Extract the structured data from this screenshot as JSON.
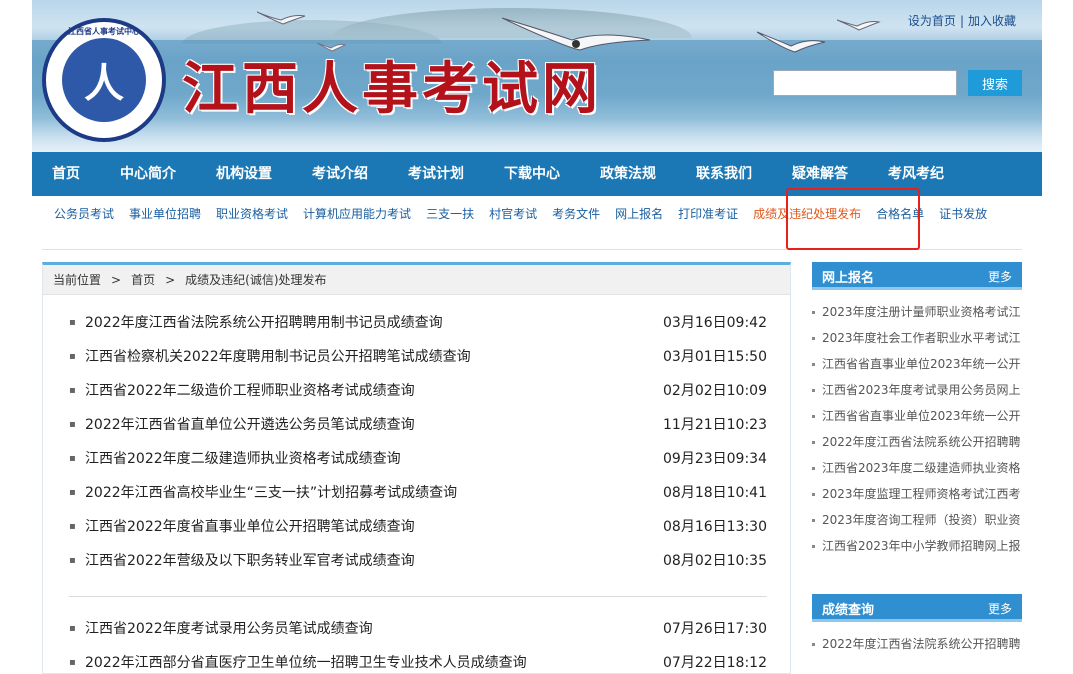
{
  "header": {
    "site_title": "江西人事考试网",
    "emblem_glyph": "人",
    "emblem_ring_text": "江西省人事考试中心",
    "top_links": [
      "设为首页",
      "加入收藏"
    ],
    "search_placeholder": "",
    "search_button": "搜索"
  },
  "main_nav": [
    "首页",
    "中心简介",
    "机构设置",
    "考试介绍",
    "考试计划",
    "下载中心",
    "政策法规",
    "联系我们",
    "疑难解答",
    "考风考纪"
  ],
  "sub_nav": {
    "items": [
      "公务员考试",
      "事业单位招聘",
      "职业资格考试",
      "计算机应用能力考试",
      "三支一扶",
      "村官考试",
      "考务文件",
      "网上报名",
      "打印准考证",
      "成绩及违纪处理发布",
      "合格名单",
      "证书发放"
    ],
    "active": "成绩及违纪处理发布"
  },
  "breadcrumb": {
    "label": "当前位置",
    "sep": ">",
    "home": "首页",
    "current": "成绩及违纪(诚信)处理发布"
  },
  "news": [
    {
      "title": "2022年度江西省法院系统公开招聘聘用制书记员成绩查询",
      "date": "03月16日09:42"
    },
    {
      "title": "江西省检察机关2022年度聘用制书记员公开招聘笔试成绩查询",
      "date": "03月01日15:50"
    },
    {
      "title": "江西省2022年二级造价工程师职业资格考试成绩查询",
      "date": "02月02日10:09"
    },
    {
      "title": "2022年江西省省直单位公开遴选公务员笔试成绩查询",
      "date": "11月21日10:23"
    },
    {
      "title": "江西省2022年度二级建造师执业资格考试成绩查询",
      "date": "09月23日09:34"
    },
    {
      "title": "2022年江西省高校毕业生“三支一扶”计划招募考试成绩查询",
      "date": "08月18日10:41"
    },
    {
      "title": "江西省2022年度省直事业单位公开招聘笔试成绩查询",
      "date": "08月16日13:30"
    },
    {
      "title": "江西省2022年营级及以下职务转业军官考试成绩查询",
      "date": "08月02日10:35"
    }
  ],
  "news2": [
    {
      "title": "江西省2022年度考试录用公务员笔试成绩查询",
      "date": "07月26日17:30"
    },
    {
      "title": "2022年江西部分省直医疗卫生单位统一招聘卫生专业技术人员成绩查询",
      "date": "07月22日18:12"
    }
  ],
  "sidebar": {
    "registration": {
      "title": "网上报名",
      "more": "更多",
      "items": [
        "2023年度注册计量师职业资格考试江",
        "2023年度社会工作者职业水平考试江",
        "江西省省直事业单位2023年统一公开",
        "江西省2023年度考试录用公务员网上",
        "江西省省直事业单位2023年统一公开",
        "2022年度江西省法院系统公开招聘聘",
        "江西省2023年度二级建造师执业资格",
        "2023年度监理工程师资格考试江西考",
        "2023年度咨询工程师（投资）职业资",
        "江西省2023年中小学教师招聘网上报"
      ]
    },
    "scores": {
      "title": "成绩查询",
      "more": "更多",
      "items": [
        "2022年度江西省法院系统公开招聘聘"
      ]
    }
  },
  "colors": {
    "nav_bg": "#1b78b5",
    "active_sub": "#e0581c",
    "title_red": "#b3121b",
    "highlight": "#e8201a"
  }
}
